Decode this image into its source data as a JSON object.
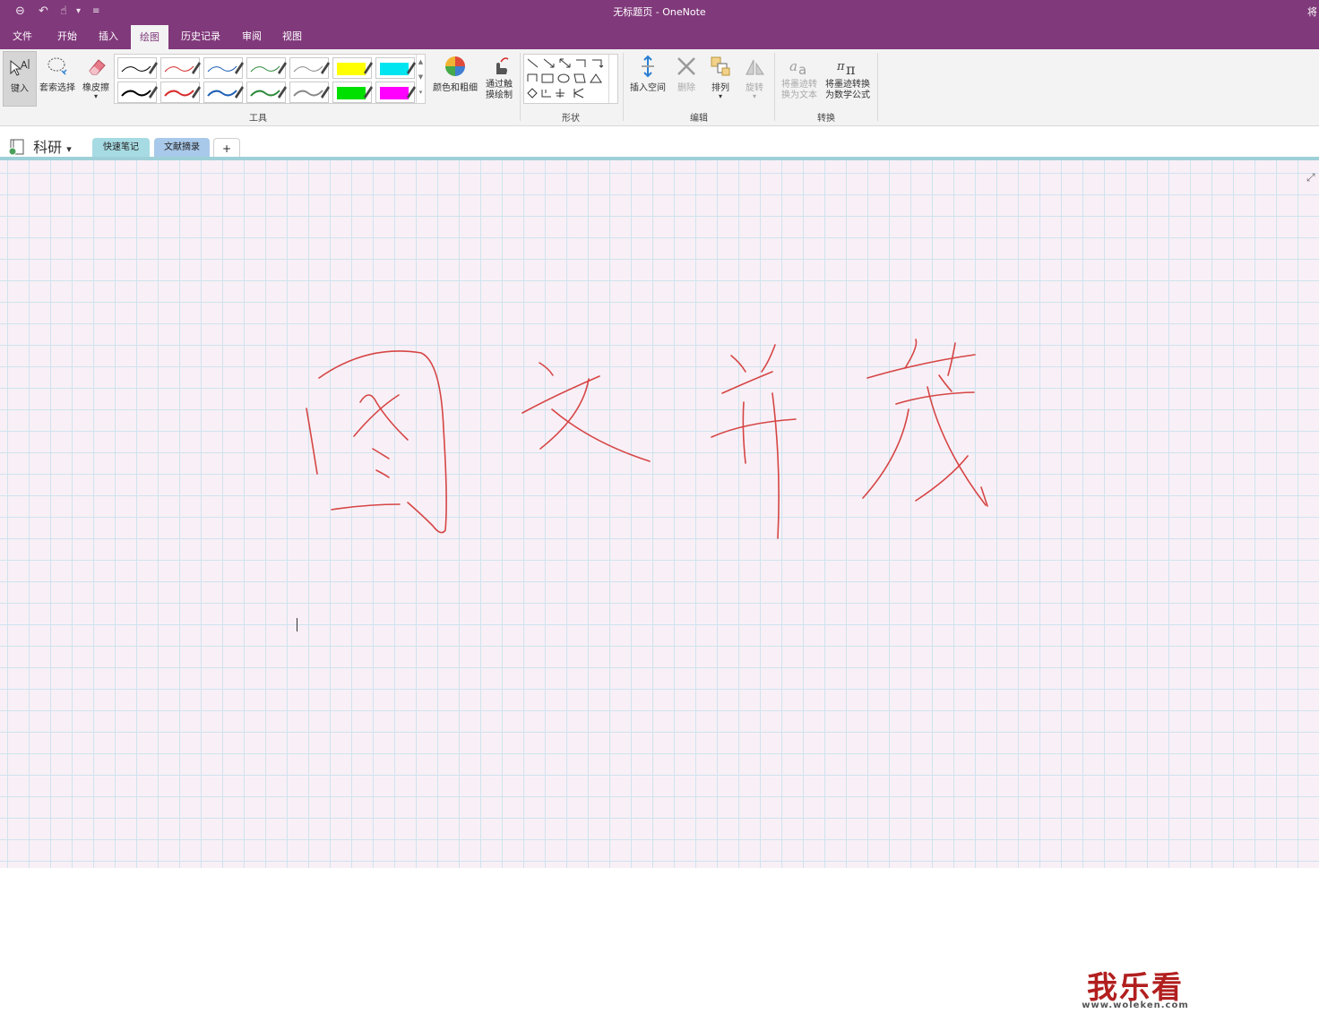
{
  "window": {
    "title": "无标题页 - OneNote",
    "user": "将"
  },
  "quick_access": {
    "back": "⊖",
    "undo": "↶",
    "touch": "☝",
    "dropdown": "▾",
    "customize": "≡"
  },
  "tabs": [
    {
      "label": "文件"
    },
    {
      "label": "开始"
    },
    {
      "label": "插入"
    },
    {
      "label": "绘图",
      "active": true
    },
    {
      "label": "历史记录"
    },
    {
      "label": "审阅"
    },
    {
      "label": "视图"
    }
  ],
  "ribbon": {
    "tools": {
      "type_label": "键入",
      "lasso_label": "套索选择",
      "eraser_label": "橡皮擦",
      "group_label": "工具",
      "color_thickness_label": "颜色和粗细",
      "touch_draw_label1": "通过触",
      "touch_draw_label2": "摸绘制"
    },
    "pens": {
      "colors": [
        "#000000",
        "#d62b2b",
        "#1f5fb4",
        "#2f8a3b",
        "#8a8a8a",
        "#ffff00",
        "#00e5f0",
        "#000000",
        "#d62b2b",
        "#1f5fb4",
        "#2f8a3b",
        "#8a8a8a",
        "#00e000",
        "#ff00ff"
      ]
    },
    "shapes": {
      "group_label": "形状"
    },
    "edit": {
      "insert_space_label": "插入空间",
      "delete_label": "删除",
      "arrange_label": "排列",
      "rotate_label": "旋转",
      "group_label": "编辑"
    },
    "convert": {
      "ink_to_text_label1": "将墨迹转",
      "ink_to_text_label2": "换为文本",
      "ink_to_math_label1": "将墨迹转换",
      "ink_to_math_label2": "为数学公式",
      "group_label": "转换"
    }
  },
  "notebook": {
    "name": "科研",
    "sections": [
      {
        "label": "快速笔记",
        "color": "#a7dbe3"
      },
      {
        "label": "文献摘录",
        "color": "#a9c9ea"
      }
    ],
    "add_label": "+"
  },
  "page": {
    "ink_color": "#d64545",
    "handwritten_text": "图文并茂",
    "expand_icon": "⤢"
  },
  "watermark": {
    "main": "我乐看",
    "sub": "www.woleken.com"
  }
}
